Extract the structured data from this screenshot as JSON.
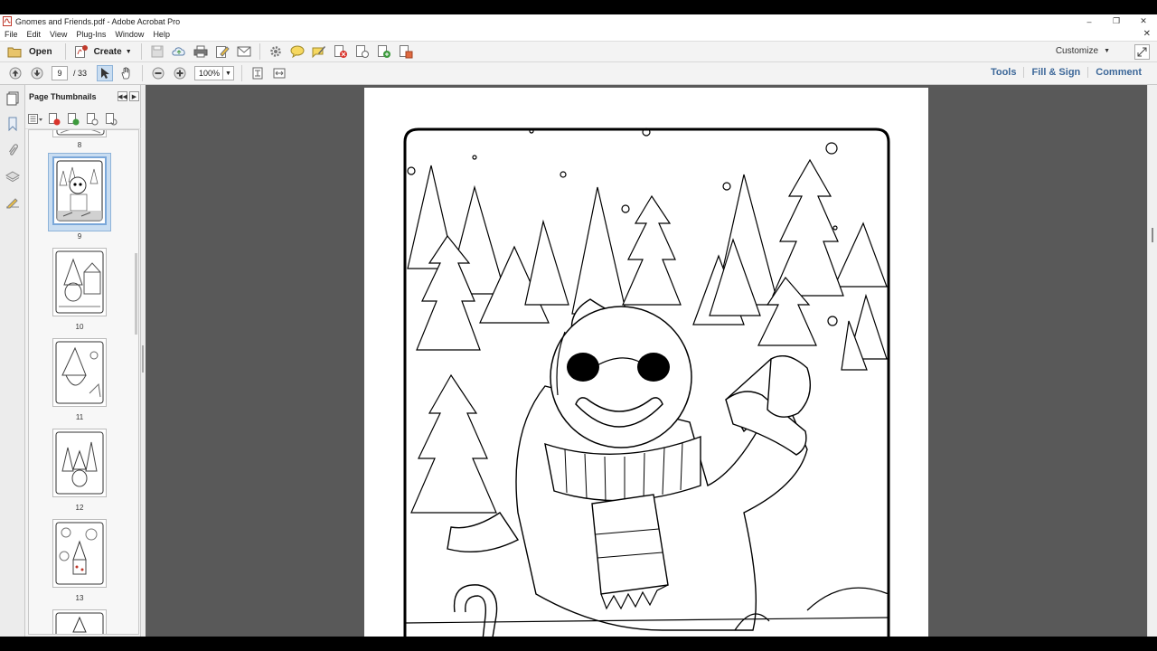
{
  "window": {
    "title": "Gnomes and Friends.pdf - Adobe Acrobat Pro",
    "controls": [
      "–",
      "❐",
      "✕"
    ]
  },
  "menu": [
    "File",
    "Edit",
    "View",
    "Plug-Ins",
    "Window",
    "Help"
  ],
  "toolbar": {
    "open_label": "Open",
    "create_label": "Create",
    "customize_label": "Customize"
  },
  "nav": {
    "current_page": "9",
    "total_pages": "/ 33",
    "zoom": "100%"
  },
  "right_links": [
    "Tools",
    "Fill & Sign",
    "Comment"
  ],
  "sidebar": {
    "panel_title": "Page Thumbnails"
  },
  "thumbnails": [
    {
      "label": "8"
    },
    {
      "label": "9"
    },
    {
      "label": "10"
    },
    {
      "label": "11"
    },
    {
      "label": "12"
    },
    {
      "label": "13"
    }
  ],
  "colors": {
    "link": "#3d6899",
    "doc_background": "#595959",
    "selection": "#c9ddf1"
  }
}
